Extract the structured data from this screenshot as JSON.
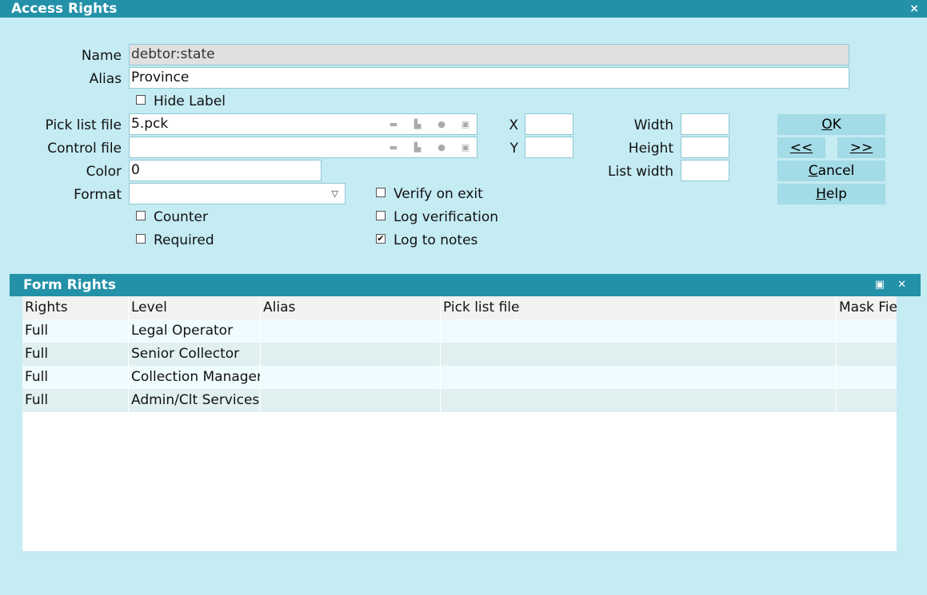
{
  "window": {
    "title": "Access Rights",
    "close_label": "×"
  },
  "form": {
    "name_label": "Name",
    "name_value": "debtor:state",
    "alias_label": "Alias",
    "alias_value": "Province",
    "hide_label": "Hide Label",
    "picklist_label": "Pick list file",
    "picklist_value": "5.pck",
    "control_label": "Control file",
    "control_value": "",
    "color_label": "Color",
    "color_value": "0",
    "format_label": "Format",
    "format_value": "",
    "x_label": "X",
    "x_value": "",
    "y_label": "Y",
    "y_value": "",
    "width_label": "Width",
    "width_value": "",
    "height_label": "Height",
    "height_value": "",
    "listwidth_label": "List width",
    "listwidth_value": "",
    "counter_label": "Counter",
    "counter_checked": false,
    "required_label": "Required",
    "required_checked": false,
    "verify_label": "Verify on exit",
    "verify_checked": false,
    "logver_label": "Log verification",
    "logver_checked": false,
    "lognotes_label": "Log to notes",
    "lognotes_checked": true,
    "hide_checked": false
  },
  "buttons": {
    "ok_first": "O",
    "ok_rest": "K",
    "prev": "<<",
    "next": ">>",
    "cancel_first": "C",
    "cancel_rest": "ancel",
    "help_first": "H",
    "help_rest": "elp"
  },
  "icons": [
    "folder-icon",
    "print-icon",
    "clear-icon",
    "lookup-icon"
  ],
  "form_rights": {
    "title": "Form Rights",
    "columns": [
      "Rights",
      "Level",
      "Alias",
      "Pick list file",
      "Mask Fie"
    ],
    "rows": [
      [
        "Full",
        "Legal Operator",
        "",
        "",
        ""
      ],
      [
        "Full",
        "Senior Collector",
        "",
        "",
        ""
      ],
      [
        "Full",
        "Collection Manager",
        "",
        "",
        ""
      ],
      [
        "Full",
        "Admin/Clt Services",
        "",
        "",
        ""
      ]
    ]
  },
  "colors": {
    "titlebar": "#2391a8",
    "background": "#c5ebf3",
    "button": "#a3dbe6"
  }
}
